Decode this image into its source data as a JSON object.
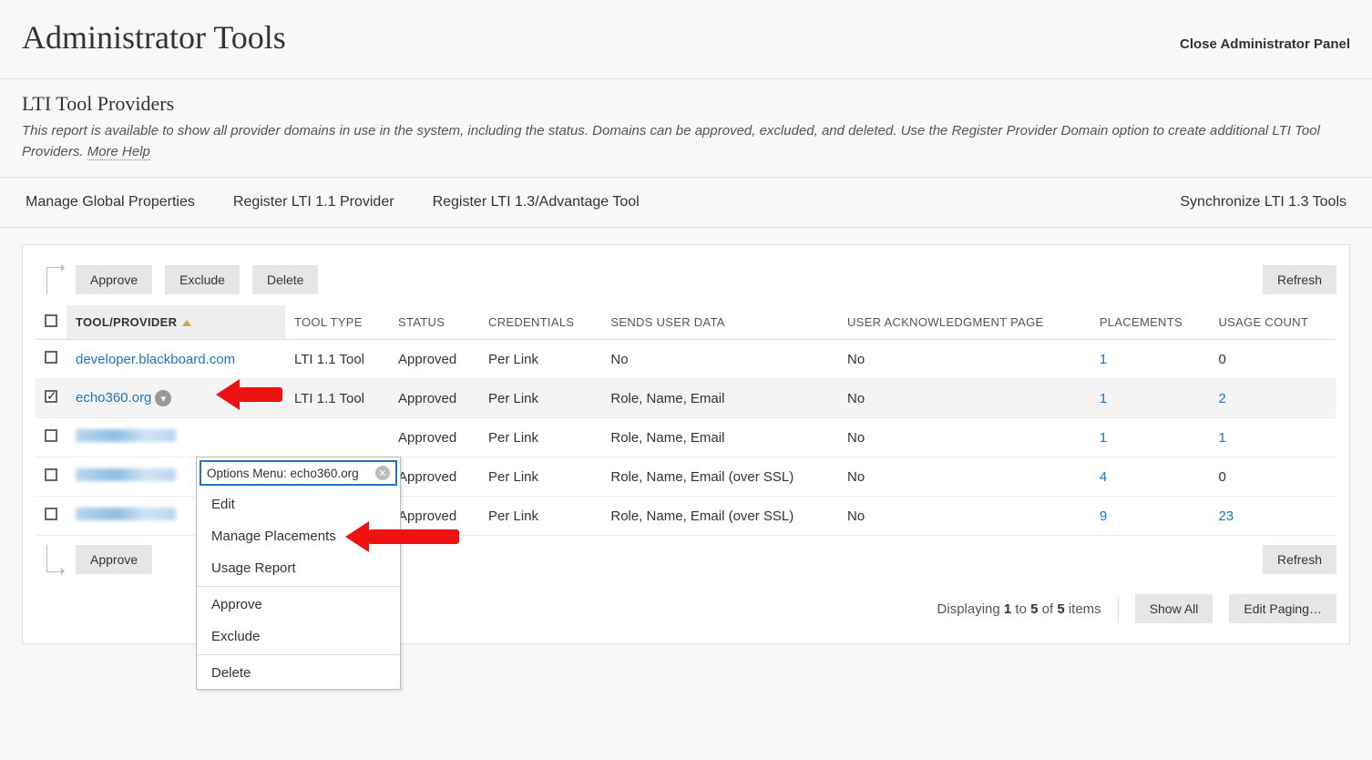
{
  "header": {
    "title": "Administrator Tools",
    "close": "Close Administrator Panel"
  },
  "subhead": {
    "title": "LTI Tool Providers",
    "desc": "This report is available to show all provider domains in use in the system, including the status. Domains can be approved, excluded, and deleted. Use the Register Provider Domain option to create additional LTI Tool Providers. ",
    "more_help": "More Help"
  },
  "nav": {
    "manage_global": "Manage Global Properties",
    "register_11": "Register LTI 1.1 Provider",
    "register_13": "Register LTI 1.3/Advantage Tool",
    "sync": "Synchronize LTI 1.3 Tools"
  },
  "actions": {
    "approve": "Approve",
    "exclude": "Exclude",
    "delete": "Delete",
    "refresh": "Refresh"
  },
  "columns": {
    "provider": "TOOL/PROVIDER",
    "tool_type": "TOOL TYPE",
    "status": "STATUS",
    "credentials": "CREDENTIALS",
    "sends": "SENDS USER DATA",
    "ack": "USER ACKNOWLEDGMENT PAGE",
    "placements": "PLACEMENTS",
    "usage": "USAGE COUNT"
  },
  "rows": [
    {
      "checked": false,
      "provider": "developer.blackboard.com",
      "tool_type": "LTI 1.1 Tool",
      "status": "Approved",
      "credentials": "Per Link",
      "sends": "No",
      "ack": "No",
      "placements": "1",
      "placements_link": true,
      "usage": "0",
      "usage_link": false,
      "redacted": false,
      "selected": false,
      "chevron": false
    },
    {
      "checked": true,
      "provider": "echo360.org",
      "tool_type": "LTI 1.1 Tool",
      "status": "Approved",
      "credentials": "Per Link",
      "sends": "Role, Name, Email",
      "ack": "No",
      "placements": "1",
      "placements_link": true,
      "usage": "2",
      "usage_link": true,
      "redacted": false,
      "selected": true,
      "chevron": true
    },
    {
      "checked": false,
      "provider": "",
      "tool_type": "",
      "status": "Approved",
      "credentials": "Per Link",
      "sends": "Role, Name, Email",
      "ack": "No",
      "placements": "1",
      "placements_link": true,
      "usage": "1",
      "usage_link": true,
      "redacted": true,
      "selected": false,
      "chevron": false
    },
    {
      "checked": false,
      "provider": "",
      "tool_type": "",
      "status": "Approved",
      "credentials": "Per Link",
      "sends": "Role, Name, Email (over SSL)",
      "ack": "No",
      "placements": "4",
      "placements_link": true,
      "usage": "0",
      "usage_link": false,
      "redacted": true,
      "selected": false,
      "chevron": false
    },
    {
      "checked": false,
      "provider": "",
      "tool_type": "",
      "status": "Approved",
      "credentials": "Per Link",
      "sends": "Role, Name, Email (over SSL)",
      "ack": "No",
      "placements": "9",
      "placements_link": true,
      "usage": "23",
      "usage_link": true,
      "redacted": true,
      "selected": false,
      "chevron": false
    }
  ],
  "context_menu": {
    "title": "Options Menu: echo360.org",
    "edit": "Edit",
    "manage_placements": "Manage Placements",
    "usage_report": "Usage Report",
    "approve": "Approve",
    "exclude": "Exclude",
    "delete": "Delete"
  },
  "paging": {
    "prefix": "Displaying ",
    "from": "1",
    "to_word": " to ",
    "to": "5",
    "of_word": " of ",
    "total": "5",
    "suffix": " items",
    "show_all": "Show All",
    "edit_paging": "Edit Paging…"
  }
}
